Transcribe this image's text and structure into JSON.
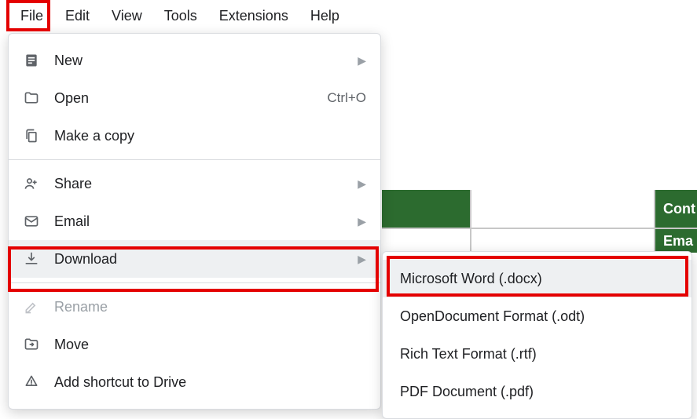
{
  "menubar": {
    "file": "File",
    "edit": "Edit",
    "view": "View",
    "tools": "Tools",
    "extensions": "Extensions",
    "help": "Help"
  },
  "file_menu": {
    "new": "New",
    "open": "Open",
    "open_shortcut": "Ctrl+O",
    "make_copy": "Make a copy",
    "share": "Share",
    "email": "Email",
    "download": "Download",
    "rename": "Rename",
    "move": "Move",
    "add_shortcut": "Add shortcut to Drive"
  },
  "download_submenu": {
    "docx": "Microsoft Word (.docx)",
    "odt": "OpenDocument Format (.odt)",
    "rtf": "Rich Text Format (.rtf)",
    "pdf": "PDF Document (.pdf)"
  },
  "background": {
    "cell_top_right": "Cont",
    "cell_bottom_right": "Ema"
  },
  "colors": {
    "highlight": "#e40000",
    "table_header": "#2c6b2f"
  }
}
